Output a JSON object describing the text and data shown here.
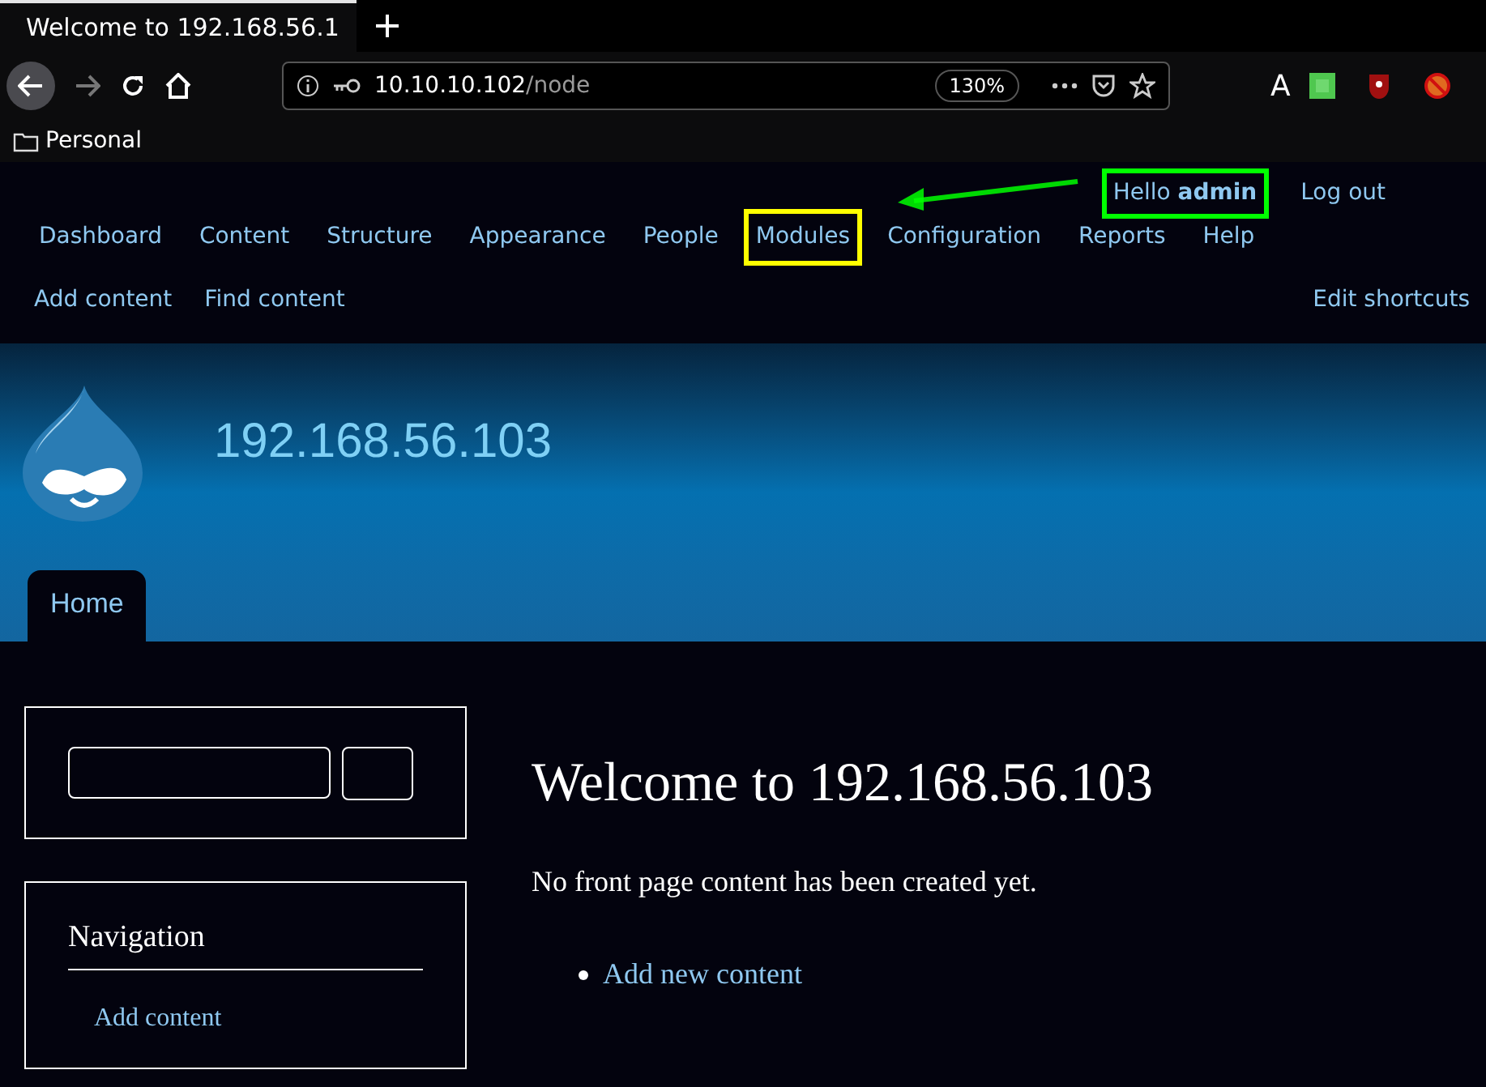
{
  "browser": {
    "tab": {
      "title": "Welcome to 192.168.56.1",
      "selected": true
    },
    "url": {
      "host": "10.10.10.102",
      "path": "/node"
    },
    "zoom": "130%",
    "extension_letter": "A",
    "bookmarks": [
      {
        "label": "Personal"
      }
    ]
  },
  "toolbar": {
    "greeting": {
      "prefix": "Hello",
      "user": "admin",
      "color": "#00ff00"
    },
    "logout": "Log out",
    "menu": [
      {
        "label": "Dashboard"
      },
      {
        "label": "Content"
      },
      {
        "label": "Structure"
      },
      {
        "label": "Appearance"
      },
      {
        "label": "People"
      },
      {
        "label": "Modules",
        "color": "#ffff00"
      },
      {
        "label": "Configuration"
      },
      {
        "label": "Reports"
      },
      {
        "label": "Help"
      }
    ],
    "shortcuts": [
      {
        "label": "Add content"
      },
      {
        "label": "Find content"
      }
    ],
    "edit_shortcuts": "Edit shortcuts"
  },
  "header": {
    "site_name": "192.168.56.103",
    "tabs": [
      {
        "label": "Home",
        "selected": true
      }
    ]
  },
  "sidebar": {
    "navigation": {
      "title": "Navigation",
      "links": [
        {
          "label": "Add content"
        }
      ]
    }
  },
  "main": {
    "title": "Welcome to 192.168.56.103",
    "message": "No front page content has been created yet.",
    "links": [
      {
        "label": "Add new content"
      }
    ]
  }
}
